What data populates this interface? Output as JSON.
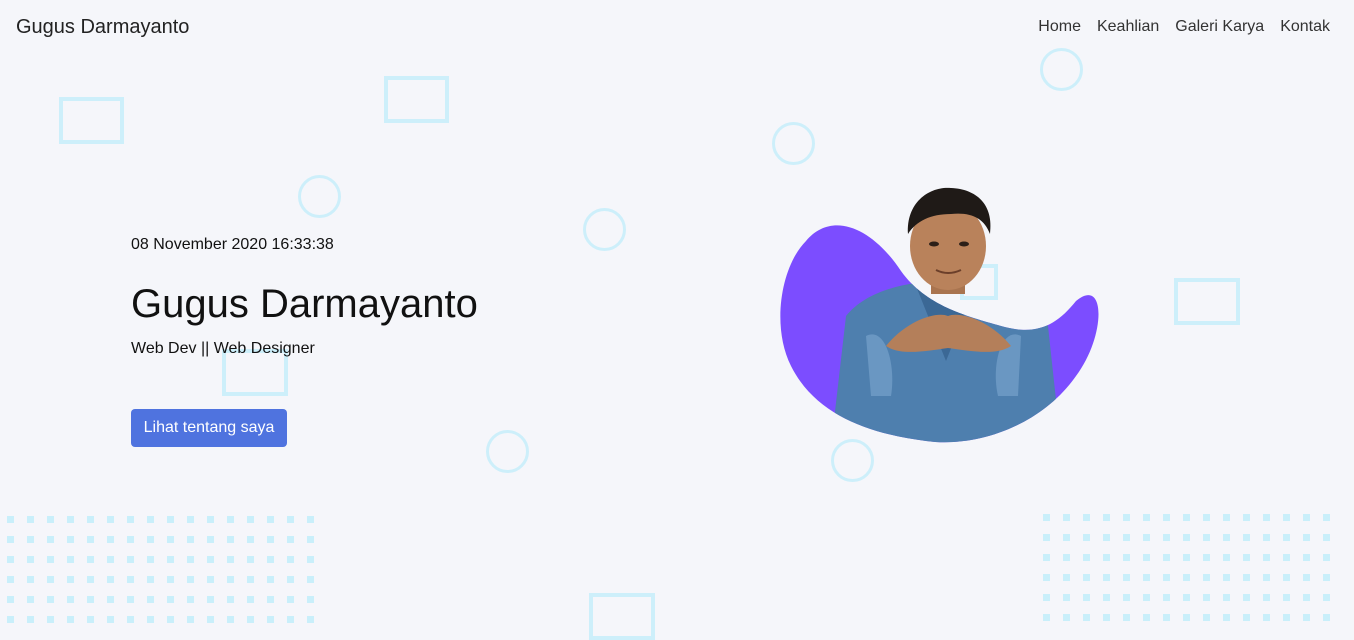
{
  "nav": {
    "brand": "Gugus Darmayanto",
    "links": [
      "Home",
      "Keahlian",
      "Galeri Karya",
      "Kontak"
    ]
  },
  "hero": {
    "datetime": "08 November 2020 16:33:38",
    "name": "Gugus Darmayanto",
    "role": "Web Dev || Web Designer",
    "cta_label": "Lihat tentang saya"
  },
  "colors": {
    "accent": "#4f73df",
    "blob": "#7c4dff",
    "decor": "#cdeffa",
    "background": "#f5f6fa"
  }
}
